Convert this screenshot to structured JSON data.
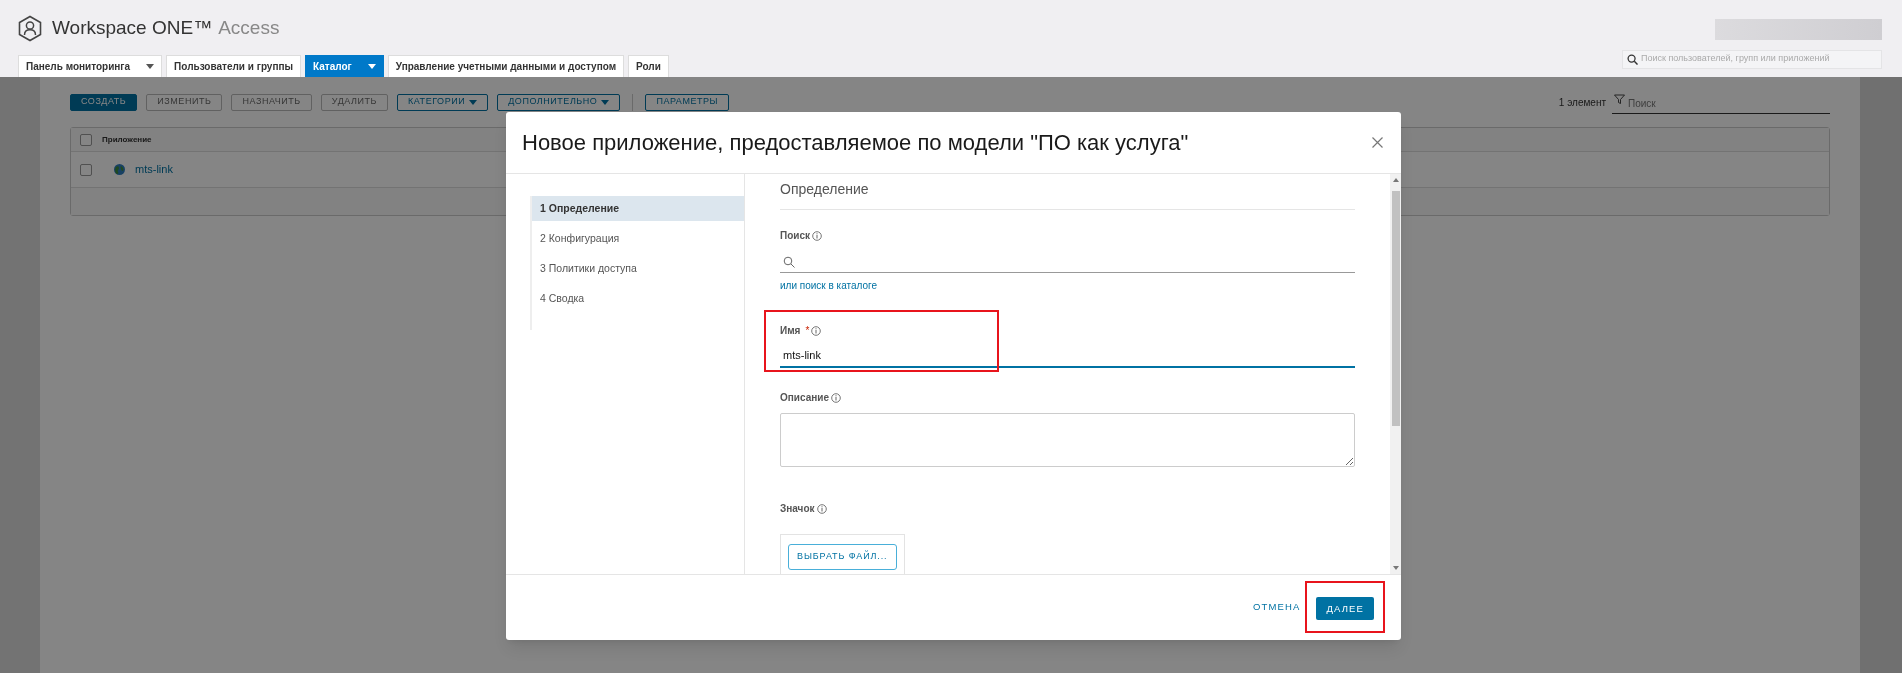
{
  "header": {
    "product": "Workspace ONE™",
    "product_suffix": "Access",
    "search": {
      "placeholder": "Поиск пользователей, групп или приложений"
    }
  },
  "tabs": [
    {
      "label": "Панель мониторинга",
      "selected": false,
      "dropdown": true
    },
    {
      "label": "Пользователи и группы",
      "selected": false,
      "dropdown": false
    },
    {
      "label": "Каталог",
      "selected": true,
      "dropdown": true
    },
    {
      "label": "Управление учетными данными и доступом",
      "selected": false,
      "dropdown": false
    },
    {
      "label": "Роли",
      "selected": false,
      "dropdown": false
    }
  ],
  "toolbar": {
    "buttons": [
      {
        "label": "СОЗДАТЬ",
        "kind": "primary"
      },
      {
        "label": "ИЗМЕНИТЬ",
        "kind": "disabled"
      },
      {
        "label": "НАЗНАЧИТЬ",
        "kind": "disabled"
      },
      {
        "label": "УДАЛИТЬ",
        "kind": "disabled"
      },
      {
        "label": "КАТЕГОРИИ",
        "kind": "menu"
      },
      {
        "label": "ДОПОЛНИТЕЛЬНО",
        "kind": "menu"
      },
      {
        "label": "ПАРАМЕТРЫ",
        "kind": "outline"
      }
    ],
    "count": "1 элемент",
    "filter_placeholder": "Поиск"
  },
  "table": {
    "select_all_checked": false,
    "columns": [
      "Приложение"
    ],
    "rows": [
      {
        "name": "mts-link",
        "checked": false
      }
    ]
  },
  "dialog": {
    "title": "Новое приложение, предоставляемое по модели \"ПО как услуга\"",
    "steps": [
      {
        "label": "1 Определение",
        "selected": true
      },
      {
        "label": "2 Конфигурация",
        "selected": false
      },
      {
        "label": "3 Политики доступа",
        "selected": false
      },
      {
        "label": "4 Сводка",
        "selected": false
      }
    ],
    "section": "Определение",
    "fields": [
      {
        "kind": "search",
        "label": "Поиск",
        "link": "или поиск в каталоге"
      },
      {
        "kind": "text",
        "label": "Имя",
        "required_mark": "*",
        "value": "mts-link",
        "focused": true,
        "highlighted": true
      },
      {
        "kind": "textarea",
        "label": "Описание"
      },
      {
        "kind": "file",
        "label": "Значок",
        "button": "ВЫБРАТЬ ФАЙЛ..."
      }
    ],
    "cancel": "ОТМЕНА",
    "next": {
      "label": "ДАЛЕЕ",
      "highlighted": true
    }
  }
}
